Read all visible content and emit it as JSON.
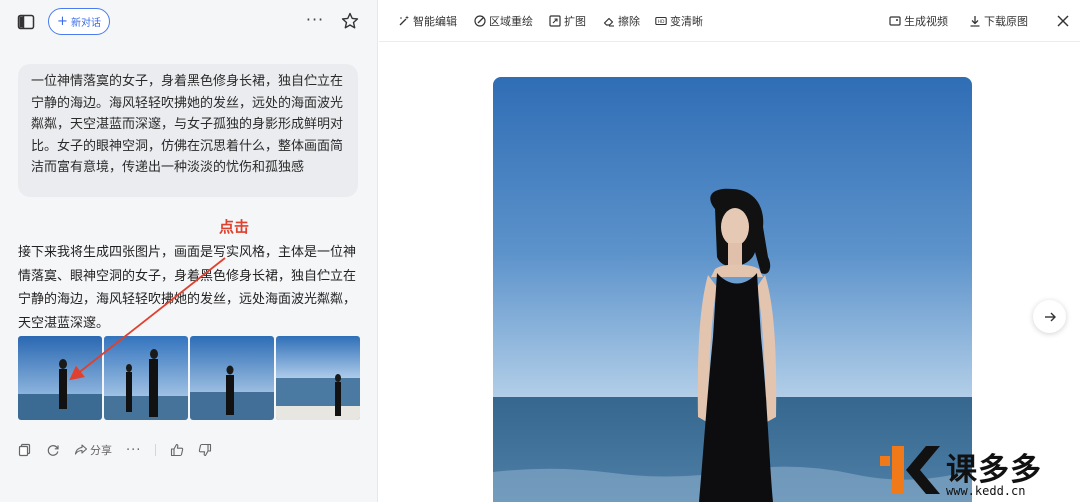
{
  "left_panel": {
    "new_chat_label": "新对话",
    "prompt_text": "一位神情落寞的女子，身着黑色修身长裙，独自伫立在宁静的海边。海风轻轻吹拂她的发丝，远处的海面波光粼粼，天空湛蓝而深邃，与女子孤独的身影形成鲜明对比。女子的眼神空洞，仿佛在沉思着什么，整体画面简洁而富有意境，传递出一种淡淡的忧伤和孤独感",
    "annotation_label": "点击",
    "reply_text": "接下来我将生成四张图片，画面是写实风格，主体是一位神情落寞、眼神空洞的女子，身着黑色修身长裙，独自伫立在宁静的海边，海风轻轻吹拂她的发丝，远处海面波光粼粼，天空湛蓝深邃。",
    "thumbnail_count": 4,
    "actions": {
      "share_label": "分享"
    }
  },
  "toolbar": {
    "items": [
      {
        "label": "智能编辑",
        "icon": "magic-wand-icon"
      },
      {
        "label": "区域重绘",
        "icon": "brush-icon"
      },
      {
        "label": "扩图",
        "icon": "expand-icon"
      },
      {
        "label": "擦除",
        "icon": "eraser-icon"
      },
      {
        "label": "变清晰",
        "icon": "hd-icon"
      }
    ],
    "generate_video_label": "生成视频",
    "download_label": "下载原图"
  },
  "watermark": {
    "brand": "课多多",
    "url": "www.kedd.cn"
  },
  "colors": {
    "accent": "#3b6be6",
    "annotation": "#e0412f",
    "sky_top": "#2e6fb8",
    "sky_bottom": "#a9c8e6",
    "sea": "#3f6f97",
    "watermark_orange": "#f07a1a"
  }
}
